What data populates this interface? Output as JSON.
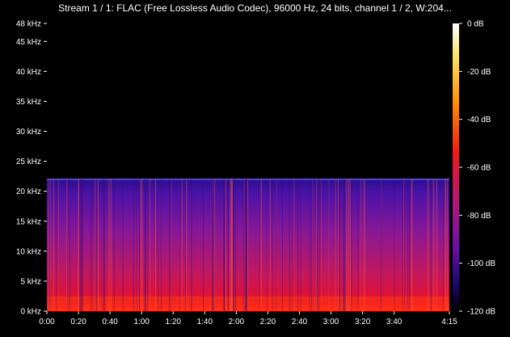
{
  "window": {
    "title": "Stream 1 / 1: FLAC (Free Lossless Audio Codec), 96000 Hz, 24 bits, channel 1 / 2, W:204..."
  },
  "chart_data": {
    "type": "heatmap",
    "title": "Stream 1 / 1: FLAC (Free Lossless Audio Codec), 96000 Hz, 24 bits, channel 1 / 2, W:204...",
    "xlabel": "",
    "ylabel": "",
    "x_ticks": [
      "0:00",
      "0:20",
      "0:40",
      "1:00",
      "1:20",
      "1:40",
      "2:00",
      "2:20",
      "2:40",
      "3:00",
      "3:20",
      "3:40",
      "4:15"
    ],
    "x_tick_seconds": [
      0,
      20,
      40,
      60,
      80,
      100,
      120,
      140,
      160,
      180,
      200,
      220,
      255
    ],
    "xlim": [
      0,
      255
    ],
    "y_ticks": [
      "0 kHz",
      "5 kHz",
      "10 kHz",
      "15 kHz",
      "20 kHz",
      "25 kHz",
      "30 kHz",
      "35 kHz",
      "40 kHz",
      "45 kHz",
      "48 kHz"
    ],
    "y_tick_values": [
      0,
      5,
      10,
      15,
      20,
      25,
      30,
      35,
      40,
      45,
      48
    ],
    "ylim": [
      0,
      48
    ],
    "colorbar": {
      "labels": [
        "0 dB",
        "-20 dB",
        "-40 dB",
        "-60 dB",
        "-80 dB",
        "-100 dB",
        "-120 dB"
      ],
      "values": [
        0,
        -20,
        -40,
        -60,
        -80,
        -100,
        -120
      ],
      "range": [
        -120,
        0
      ]
    },
    "content_cutoff_khz": 22,
    "colormap": [
      "#000000",
      "#1a0a5e",
      "#5a0fa0",
      "#b0207a",
      "#e8102a",
      "#ff6a00",
      "#ffd600",
      "#ffffff"
    ]
  }
}
